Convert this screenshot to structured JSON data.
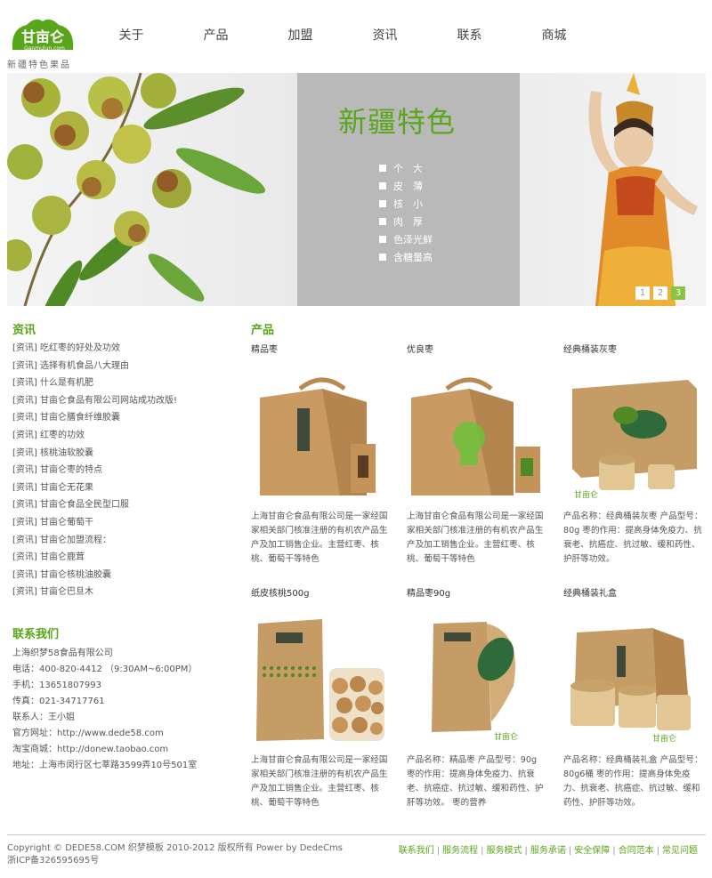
{
  "header": {
    "logo_text": "甘亩仑",
    "logo_url": "Ganmulun.com",
    "logo_sub": "新疆特色果品",
    "nav": [
      "关于",
      "产品",
      "加盟",
      "资讯",
      "联系",
      "商城"
    ]
  },
  "banner": {
    "title": "新疆特色",
    "features": [
      "个　大",
      "皮　薄",
      "核　小",
      "肉　厚",
      "色泽光鲜",
      "含糖量高"
    ],
    "pager": [
      "1",
      "2",
      "3"
    ],
    "active_page": "3",
    "accent_color": "#8bc43f"
  },
  "news": {
    "title": "资讯",
    "items": [
      "[资讯] 吃红枣的好处及功效",
      "[资讯] 选择有机食品八大理由",
      "[资讯] 什么是有机肥",
      "[资讯] 甘亩仑食品有限公司网站成功改版!",
      "[资讯] 甘亩仑膳食纤维胶囊",
      "[资讯] 红枣的功效",
      "[资讯] 核桃油软胶囊",
      "[资讯] 甘亩仑枣的特点",
      "[资讯] 甘亩仑无花果",
      "[资讯] 甘亩仑食品全民型口服",
      "[资讯] 甘亩仑葡萄干",
      "[资讯] 甘亩仑加盟流程：",
      "[资讯] 甘亩仑鹿茸",
      "[资讯] 甘亩仑核桃油胶囊",
      "[资讯] 甘亩仑巴旦木"
    ]
  },
  "contact": {
    "title": "联系我们",
    "lines": [
      "上海织梦58食品有限公司",
      "电话：400-820-4412 （9:30AM~6:00PM）",
      "手机：13651807993",
      "传真：021-34717761",
      "联系人：王小姐",
      "官方网址：http://www.dede58.com",
      "淘宝商城：http://donew.taobao.com",
      "地址：上海市闵行区七莘路3599弄10号501室"
    ]
  },
  "products": {
    "title": "产品",
    "items": [
      {
        "name": "精品枣",
        "desc": "上海甘亩仑食品有限公司是一家经国家相关部门核准注册的有机农产品生产及加工销售企业。主营红枣、核桃、葡萄干等特色"
      },
      {
        "name": "优良枣",
        "desc": "上海甘亩仑食品有限公司是一家经国家相关部门核准注册的有机农产品生产及加工销售企业。主营红枣、核桃、葡萄干等特色"
      },
      {
        "name": "经典桶装灰枣",
        "desc": "产品名称：经典桶装灰枣 产品型号：80g 枣的作用：提高身体免疫力、抗衰老、抗癌症、抗过敏、缓和药性、护肝等功效。"
      },
      {
        "name": "纸皮核桃500g",
        "desc": "上海甘亩仑食品有限公司是一家经国家相关部门核准注册的有机农产品生产及加工销售企业。主营红枣、核桃、葡萄干等特色"
      },
      {
        "name": "精品枣90g",
        "desc": "产品名称：精品枣 产品型号：90g 枣的作用：提高身体免疫力、抗衰老、抗癌症、抗过敏、缓和药性、护肝等功效。 枣的营养"
      },
      {
        "name": "经典桶装礼盒",
        "desc": "产品名称：经典桶装礼盒 产品型号：80g6桶 枣的作用：提高身体免疫力、抗衰老、抗癌症、抗过敏、缓和药性、护肝等功效。"
      }
    ]
  },
  "footer": {
    "copyright": "Copyright © DEDE58.COM 织梦模板 2010-2012 版权所有 Power by DedeCms",
    "icp": "浙ICP备326595695号",
    "links": [
      "联系我们",
      "服务流程",
      "服务模式",
      "服务承诺",
      "安全保障",
      "合同范本",
      "常见问题"
    ]
  }
}
